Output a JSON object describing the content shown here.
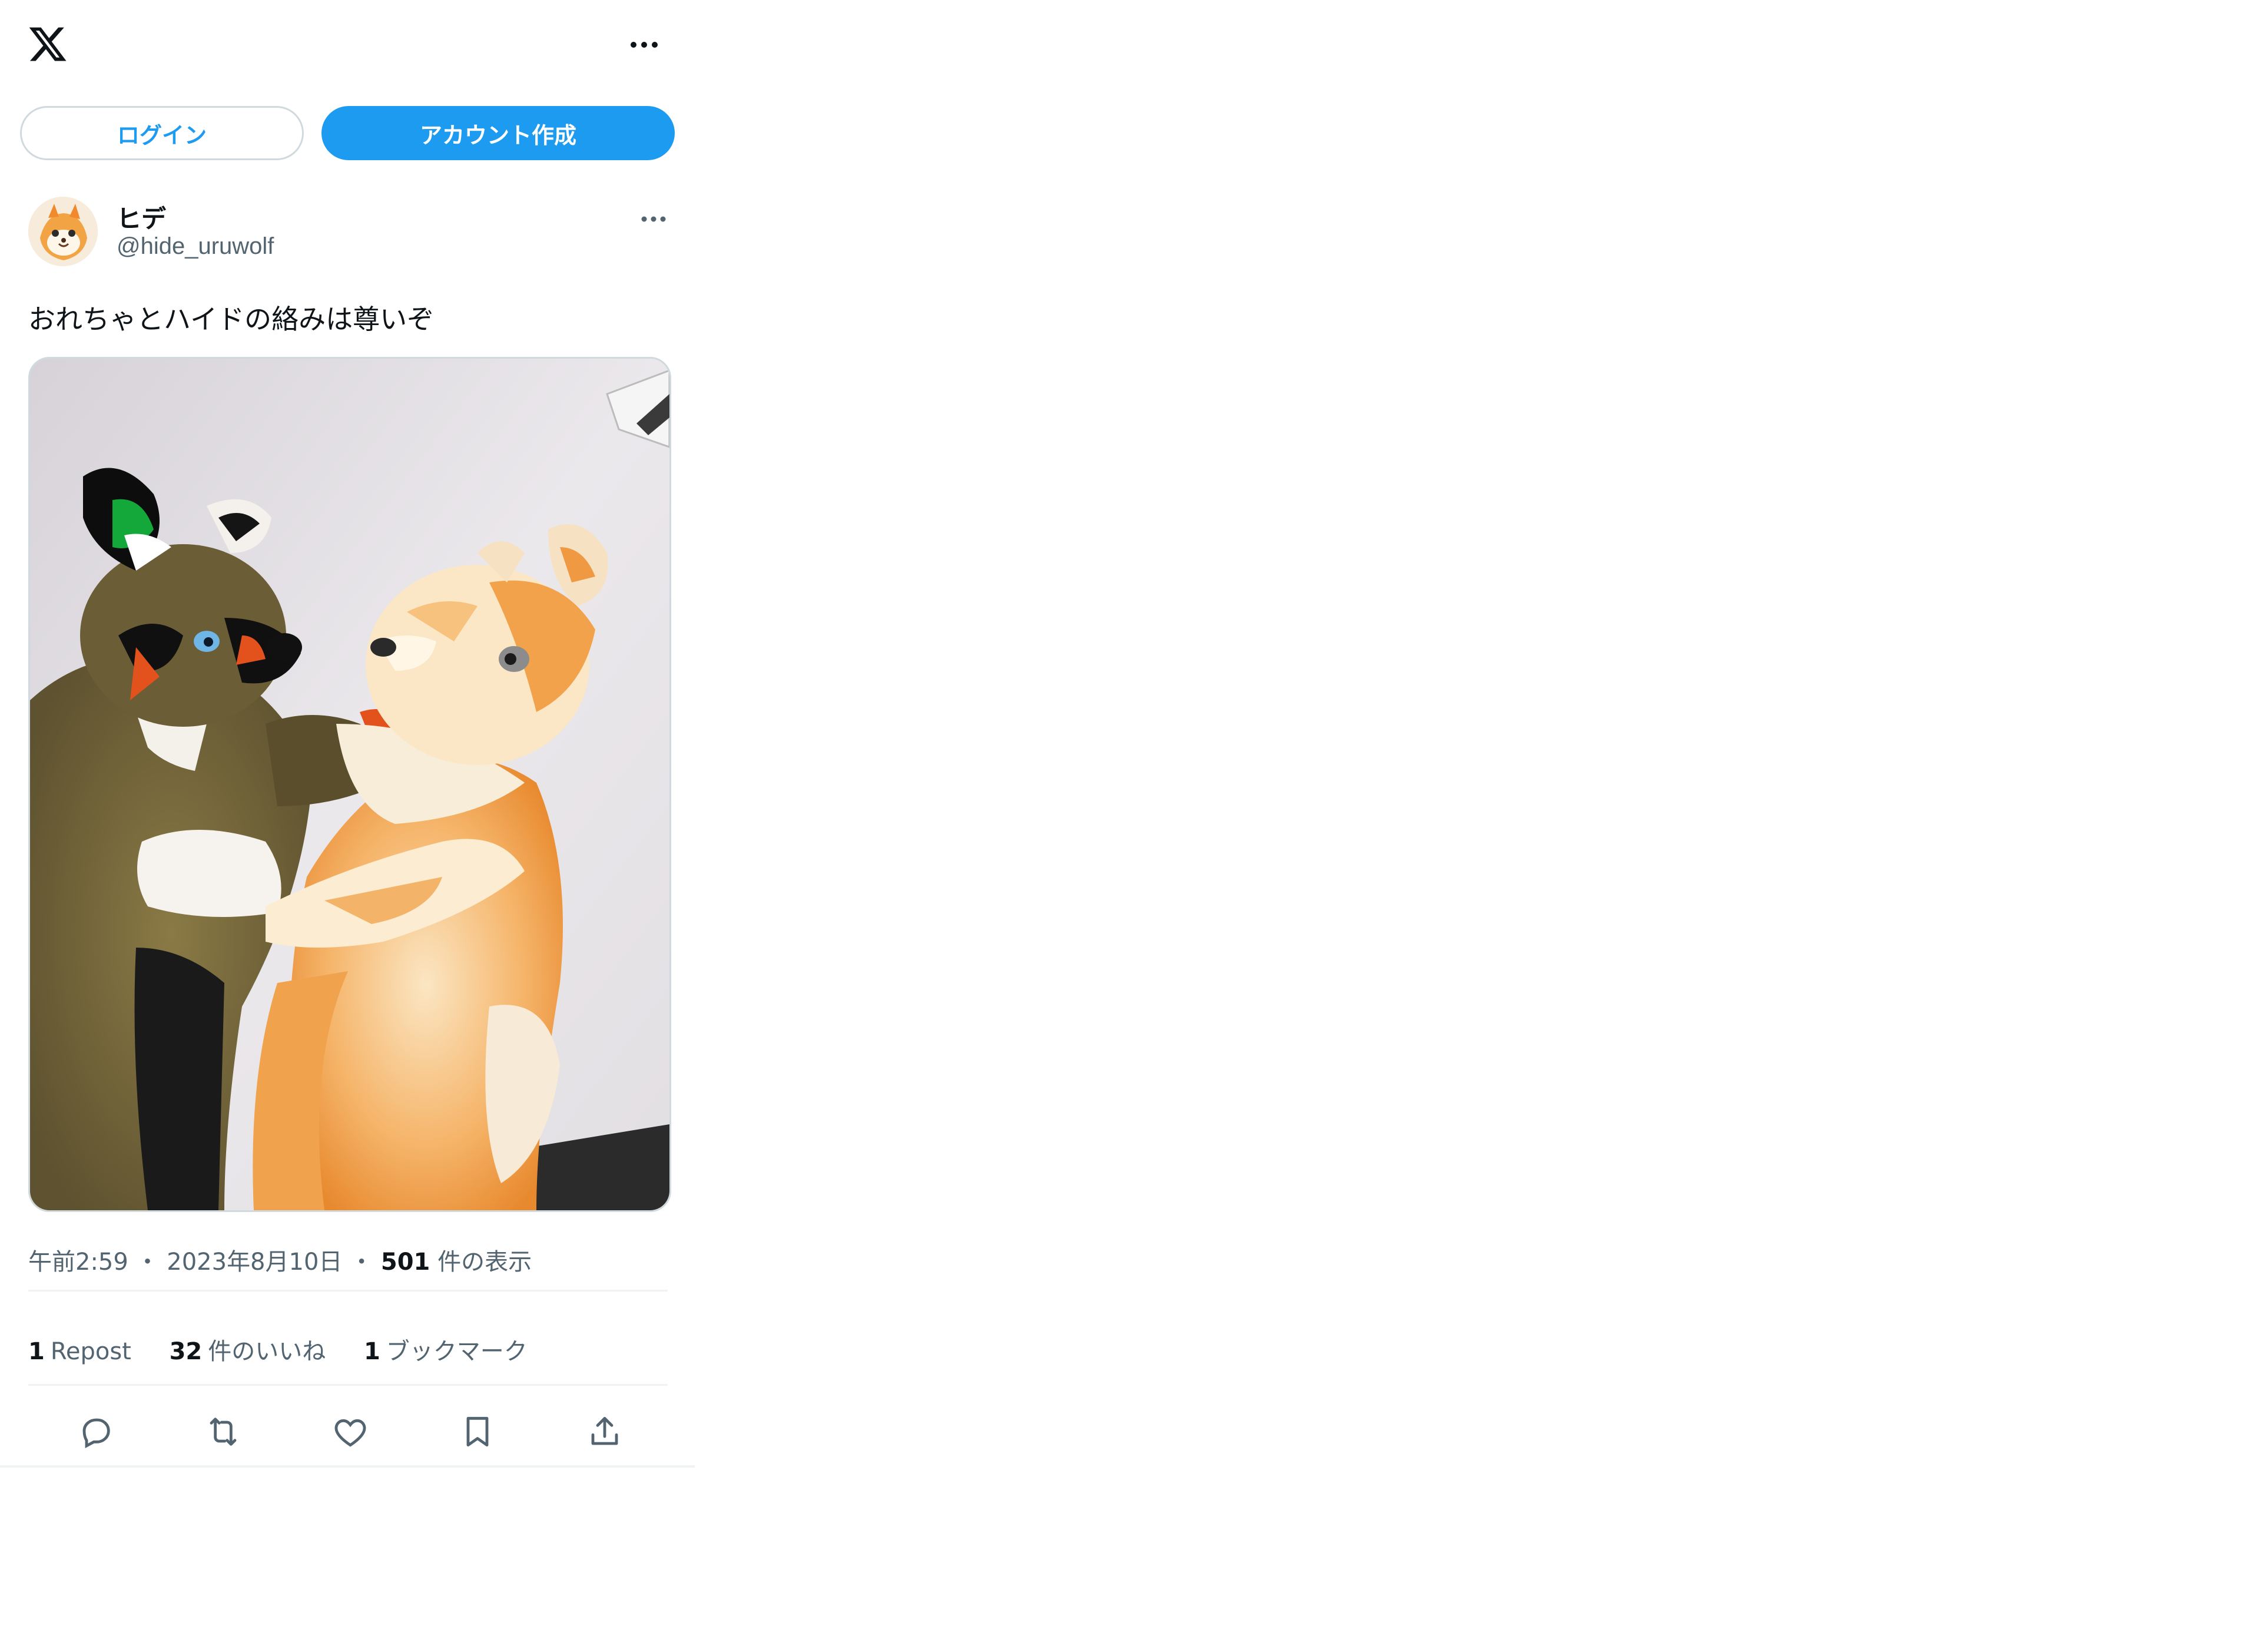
{
  "topbar": {
    "logo_icon": "x-logo-icon",
    "more_icon": "more-horizontal-icon"
  },
  "auth": {
    "login_label": "ログイン",
    "signup_label": "アカウント作成"
  },
  "post": {
    "author": {
      "display_name": "ヒデ",
      "handle": "@hide_uruwolf",
      "avatar_icon": "avatar"
    },
    "text": "おれちゃとハイドの絡みは尊いぞ",
    "media_alt": "furry-costume-photo",
    "meta": {
      "time": "午前2:59",
      "separator": "・",
      "date": "2023年8月10日",
      "views_count": "501",
      "views_label": "件の表示"
    },
    "stats": {
      "repost_count": "1",
      "repost_label": "Repost",
      "likes_count": "32",
      "likes_label": "件のいいね",
      "bookmarks_count": "1",
      "bookmarks_label": "ブックマーク"
    },
    "actions": [
      "reply-icon",
      "repost-icon",
      "like-icon",
      "bookmark-icon",
      "share-icon"
    ]
  },
  "colors": {
    "accent": "#1d9bf0",
    "text_primary": "#0f1419",
    "text_secondary": "#536471",
    "border": "#cfd9de"
  }
}
